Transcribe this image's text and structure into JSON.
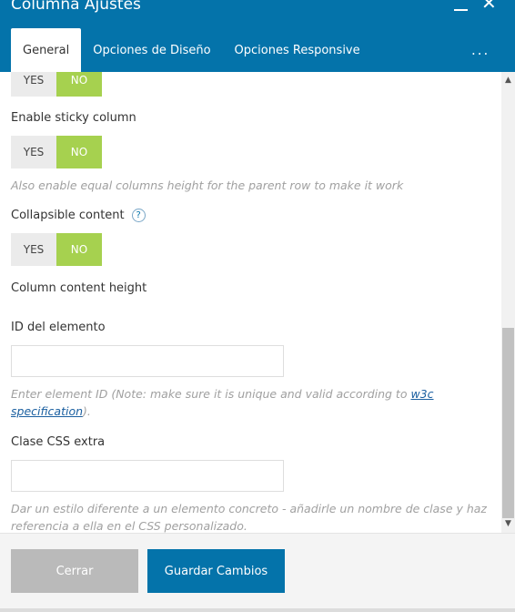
{
  "header": {
    "title": "Columna Ajustes",
    "minimize_icon": "minimize-icon",
    "close_icon": "close-icon",
    "close_glyph": "✕",
    "more_glyph": "...",
    "tabs": [
      {
        "label": "General",
        "active": true
      },
      {
        "label": "Opciones de Diseño",
        "active": false
      },
      {
        "label": "Opciones Responsive",
        "active": false
      }
    ]
  },
  "toggle": {
    "yes": "YES",
    "no": "NO"
  },
  "fields": {
    "sticky_label": "Enable sticky column",
    "sticky_hint": "Also enable equal columns height for the parent row to make it work",
    "collapsible_label": "Collapsible content",
    "help_glyph": "?",
    "content_height_label": "Column content height",
    "element_id_label": "ID del elemento",
    "element_id_value": "",
    "element_id_hint_prefix": "Enter element ID (Note: make sure it is unique and valid according to ",
    "element_id_hint_link": "w3c specification",
    "element_id_hint_suffix": ").",
    "css_class_label": "Clase CSS extra",
    "css_class_value": "",
    "css_class_hint": "Dar un estilo diferente a un elemento concreto - añadirle un nombre de clase y haz referencia a ella en el CSS personalizado."
  },
  "footer": {
    "close_label": "Cerrar",
    "save_label": "Guardar Cambios"
  },
  "colors": {
    "header": "#0473aa",
    "toggle_on": "#a6d14f",
    "toggle_off": "#ebebeb",
    "save_button": "#0473aa",
    "close_button": "#bababa"
  }
}
